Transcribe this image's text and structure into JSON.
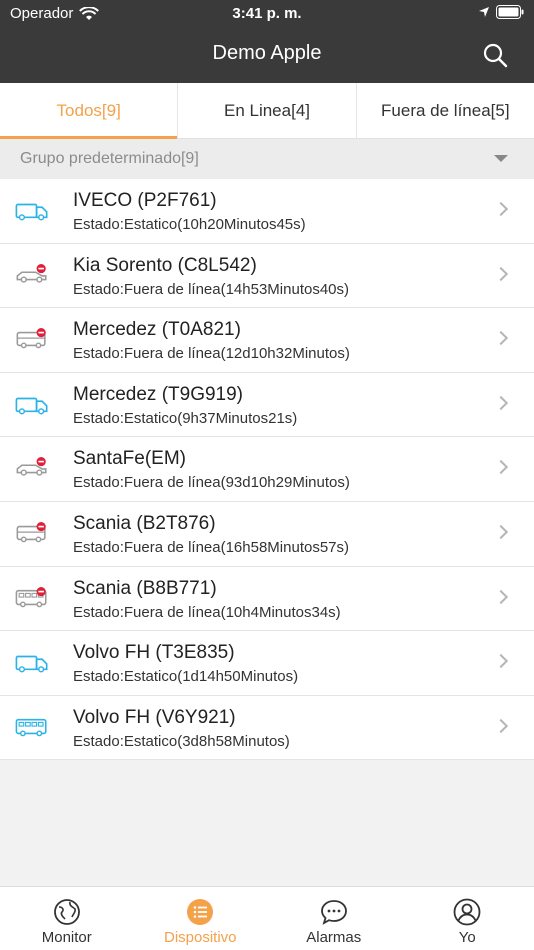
{
  "status_bar": {
    "carrier": "Operador",
    "time": "3:41 p. m."
  },
  "header": {
    "title": "Demo Apple",
    "search_icon": "search-icon"
  },
  "tabs": [
    {
      "label": "Todos[9]",
      "active": true
    },
    {
      "label": "En Linea[4]",
      "active": false
    },
    {
      "label": "Fuera de línea[5]",
      "active": false
    }
  ],
  "group": {
    "label": "Grupo predeterminado[9]"
  },
  "devices": [
    {
      "name": "IVECO (P2F761)",
      "state": "Estado:Estatico(10h20Minutos45s)",
      "icon": "truck-icon",
      "online": true
    },
    {
      "name": "Kia Sorento (C8L542)",
      "state": "Estado:Fuera de línea(14h53Minutos40s)",
      "icon": "car-icon",
      "online": false
    },
    {
      "name": "Mercedez (T0A821)",
      "state": "Estado:Fuera de línea(12d10h32Minutos)",
      "icon": "van-icon",
      "online": false
    },
    {
      "name": "Mercedez (T9G919)",
      "state": "Estado:Estatico(9h37Minutos21s)",
      "icon": "truck-icon",
      "online": true
    },
    {
      "name": "SantaFe(EM)",
      "state": "Estado:Fuera de línea(93d10h29Minutos)",
      "icon": "car-icon",
      "online": false
    },
    {
      "name": "Scania (B2T876)",
      "state": "Estado:Fuera de línea(16h58Minutos57s)",
      "icon": "van-icon",
      "online": false
    },
    {
      "name": "Scania (B8B771)",
      "state": "Estado:Fuera de línea(10h4Minutos34s)",
      "icon": "bus-icon",
      "online": false
    },
    {
      "name": "Volvo FH (T3E835)",
      "state": "Estado:Estatico(1d14h50Minutos)",
      "icon": "truck-icon",
      "online": true
    },
    {
      "name": "Volvo FH (V6Y921)",
      "state": "Estado:Estatico(3d8h58Minutos)",
      "icon": "bus-icon",
      "online": true
    }
  ],
  "tabbar": [
    {
      "label": "Monitor",
      "icon": "globe-icon",
      "active": false
    },
    {
      "label": "Dispositivo",
      "icon": "list-icon",
      "active": true
    },
    {
      "label": "Alarmas",
      "icon": "chat-bubble-icon",
      "active": false
    },
    {
      "label": "Yo",
      "icon": "user-icon",
      "active": false
    }
  ],
  "colors": {
    "accent": "#f5a14a",
    "online": "#2bb3e6",
    "offline": "#9a9a9a",
    "alert": "#e0203a",
    "header_bg": "#3a3a3a"
  }
}
